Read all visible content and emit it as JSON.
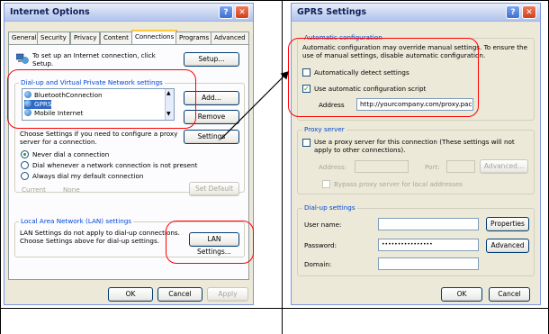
{
  "internet_options": {
    "title": "Internet Options",
    "tabs": [
      "General",
      "Security",
      "Privacy",
      "Content",
      "Connections",
      "Programs",
      "Advanced"
    ],
    "active_tab_index": 4,
    "setup_text_1": "To set up an Internet connection, click",
    "setup_text_2": "Setup.",
    "setup_button": "Setup...",
    "dialup_group": "Dial-up and Virtual Private Network settings",
    "connections": [
      "BluetoothConnection",
      "GPRS",
      "Mobile Internet"
    ],
    "selected_connection": "GPRS",
    "add_button": "Add...",
    "remove_button": "Remove",
    "proxy_text_1": "Choose Settings if you need to configure a proxy",
    "proxy_text_2": "server for a connection.",
    "settings_button": "Settings",
    "radio_never": "Never dial a connection",
    "radio_dial_when": "Dial whenever a network connection is not present",
    "radio_always": "Always dial my default connection",
    "current_label": "Current",
    "current_value": "None",
    "set_default_button": "Set Default",
    "lan_group": "Local Area Network (LAN) settings",
    "lan_text_1": "LAN Settings do not apply to dial-up connections.",
    "lan_text_2": "Choose Settings above for dial-up settings.",
    "lan_button": "LAN Settings...",
    "ok": "OK",
    "cancel": "Cancel",
    "apply": "Apply"
  },
  "gprs_settings": {
    "title": "GPRS Settings",
    "auto_group": "Automatic configuration",
    "auto_text_1": "Automatic configuration may override manual settings.  To ensure the",
    "auto_text_2": "use of manual settings, disable automatic configuration.",
    "auto_detect": "Automatically detect settings",
    "auto_detect_checked": false,
    "use_script": "Use automatic configuration script",
    "use_script_checked": true,
    "address_label": "Address",
    "address_value": "http://yourcompany.com/proxy.pac",
    "proxy_group": "Proxy server",
    "proxy_check_1": "Use a proxy server for this connection (These settings will not",
    "proxy_check_2": "apply to other connections).",
    "proxy_address_label": "Address:",
    "port_label": "Port:",
    "advanced_button_disabled": "Advanced...",
    "bypass_label": "Bypass proxy server for local addresses",
    "dialup_group": "Dial-up settings",
    "user_name_label": "User name:",
    "password_label": "Password:",
    "password_value": "••••••••••••••••",
    "domain_label": "Domain:",
    "properties_button": "Properties",
    "advanced_button": "Advanced",
    "ok": "OK",
    "cancel": "Cancel"
  },
  "colors": {
    "highlight_circle": "#ff0000",
    "arrow": "#000000"
  }
}
